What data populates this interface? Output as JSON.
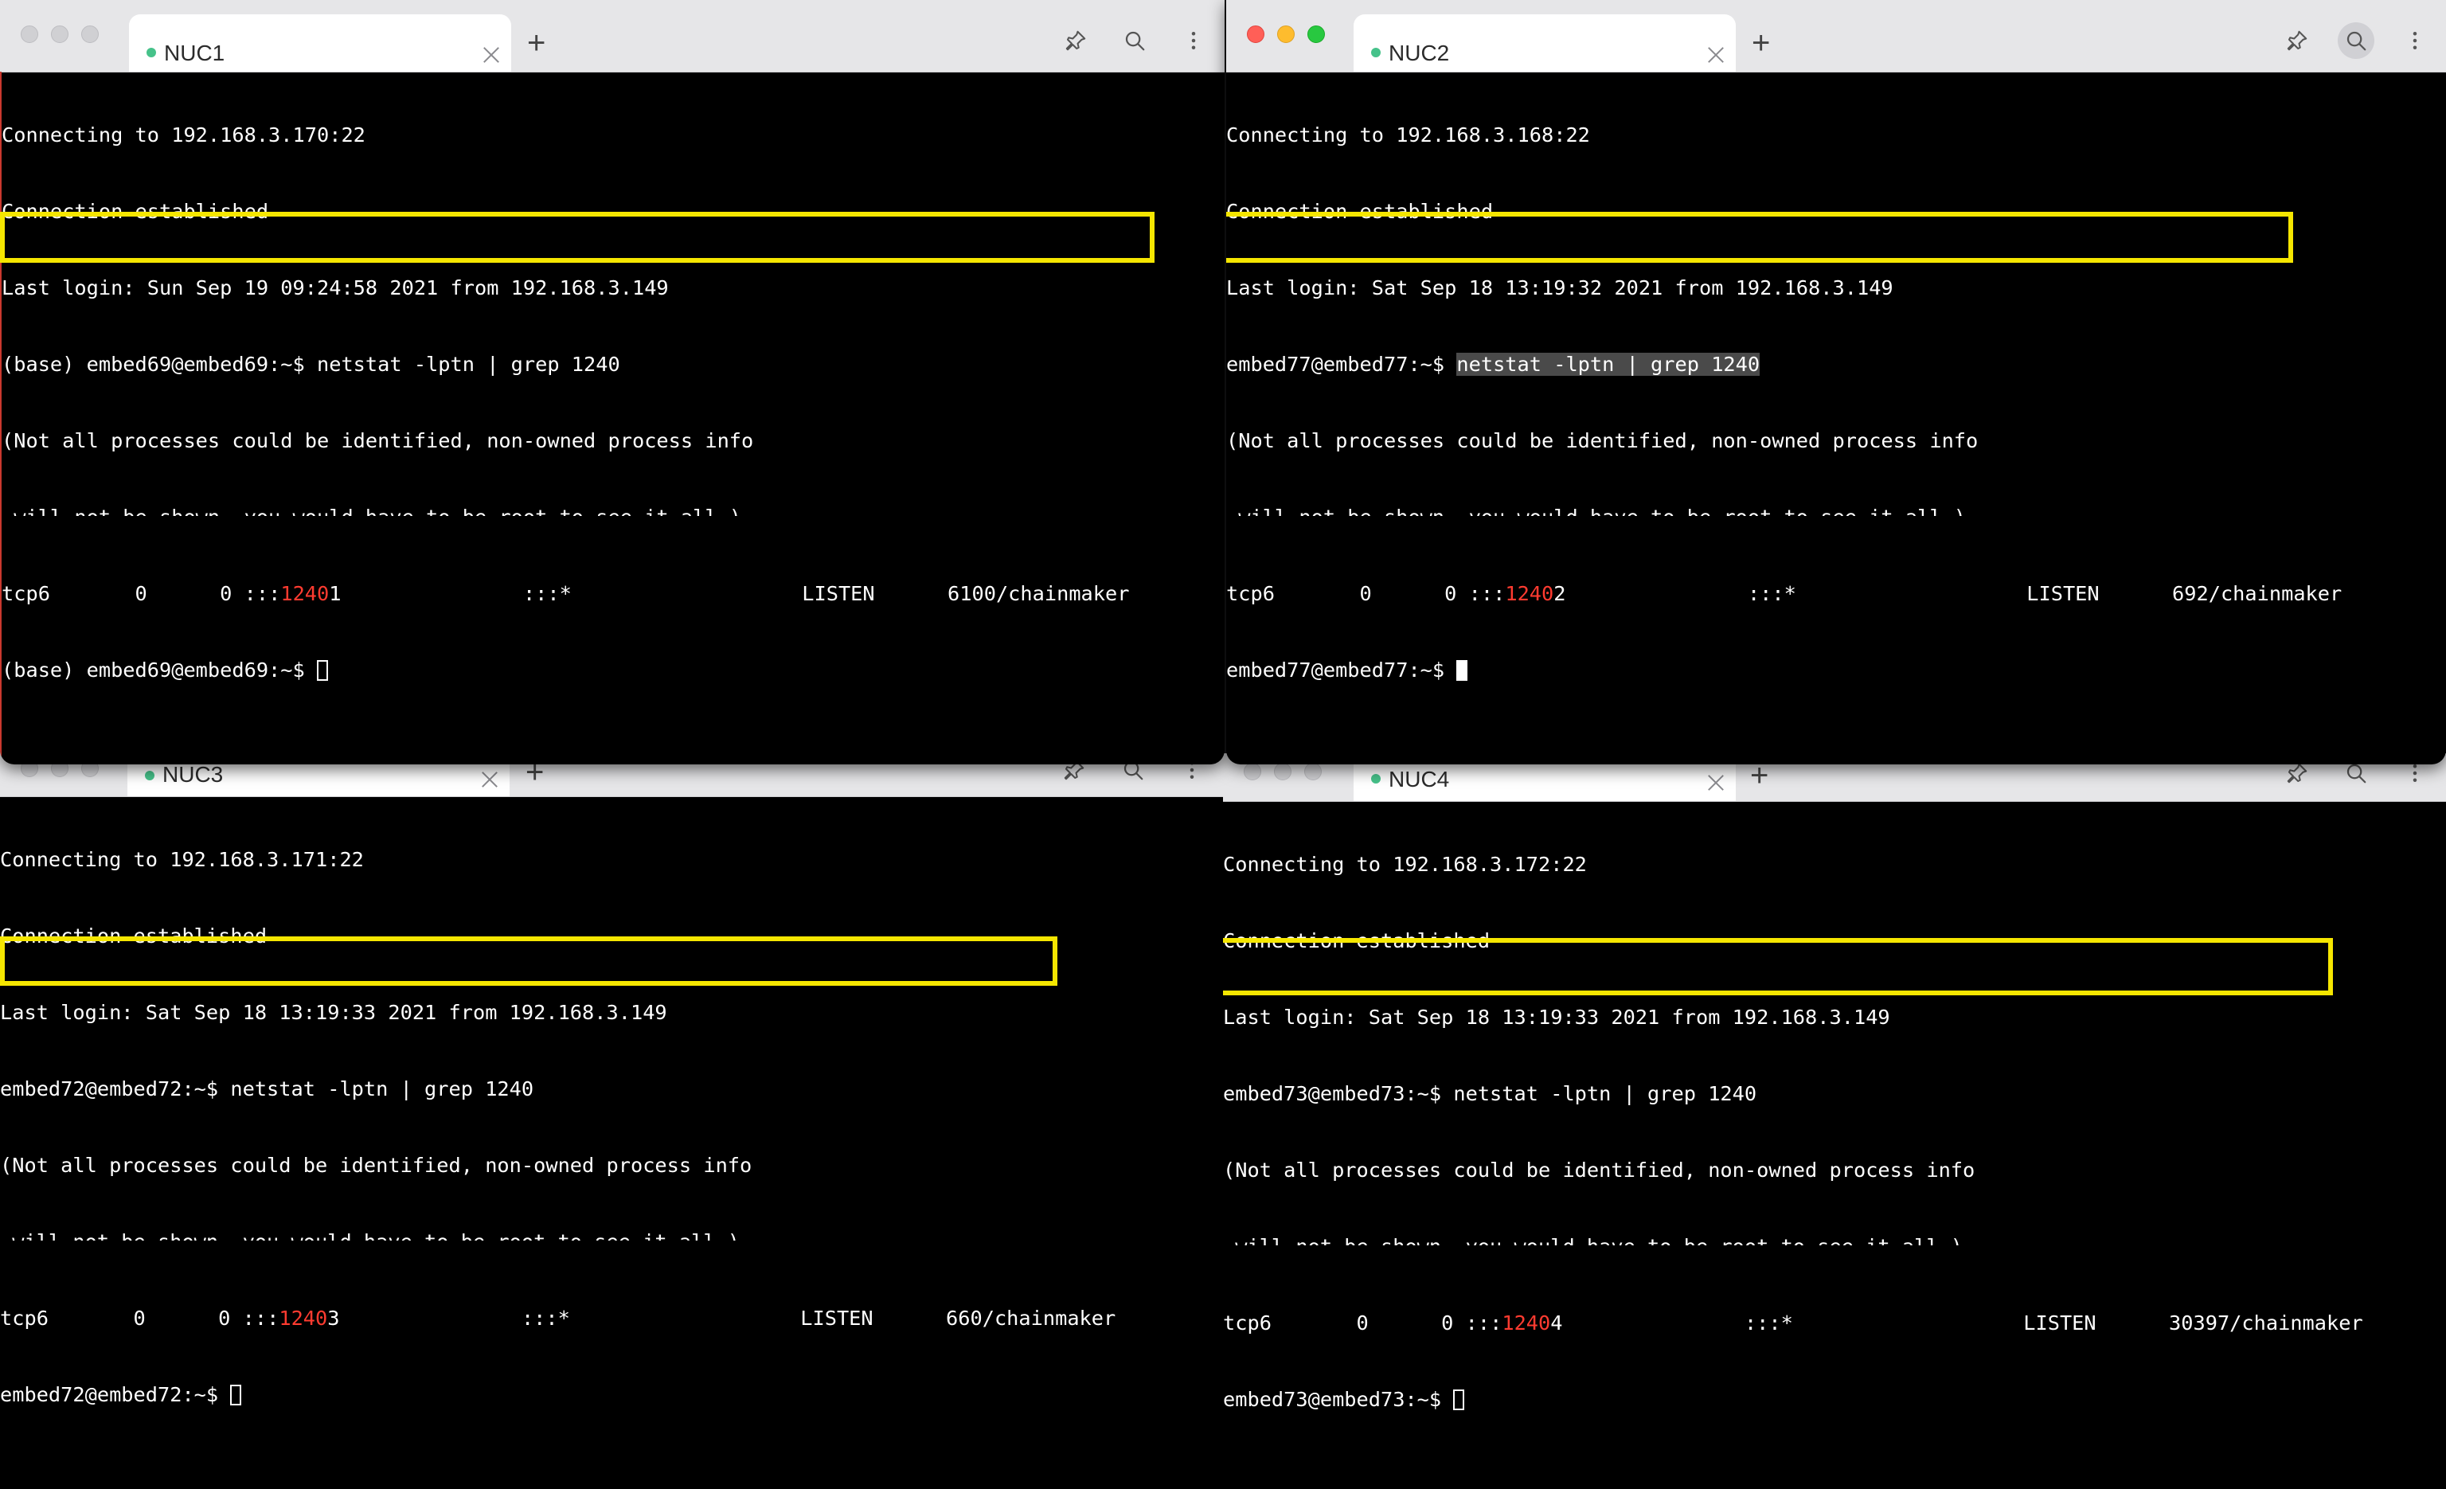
{
  "windows": [
    {
      "tab_title": "NUC1",
      "lines": [
        "Connecting to 192.168.3.170:22",
        "Connection established",
        "Last login: Sun Sep 19 09:24:58 2021 from 192.168.3.149",
        "(base) embed69@embed69:~$ netstat -lptn | grep 1240",
        "(Not all processes could be identified, non-owned process info",
        " will not be shown, you would have to be root to see it all.)"
      ],
      "result": {
        "proto": "tcp6",
        "recvq": "0",
        "sendq": "0",
        "addr_prefix": ":::",
        "port_match": "1240",
        "port_rest": "1",
        "foreign": ":::*",
        "state": "LISTEN",
        "pid": "6100/chainmaker"
      },
      "prompt": "(base) embed69@embed69:~$ "
    },
    {
      "tab_title": "NUC2",
      "lines": [
        "Connecting to 192.168.3.168:22",
        "Connection established",
        "Last login: Sat Sep 18 13:19:32 2021 from 192.168.3.149"
      ],
      "cmd_prompt": "embed77@embed77:~$ ",
      "cmd_selected": "netstat -lptn | grep 1240",
      "lines_after": [
        "(Not all processes could be identified, non-owned process info",
        " will not be shown, you would have to be root to see it all.)"
      ],
      "result": {
        "proto": "tcp6",
        "recvq": "0",
        "sendq": "0",
        "addr_prefix": ":::",
        "port_match": "1240",
        "port_rest": "2",
        "foreign": ":::*",
        "state": "LISTEN",
        "pid": "692/chainmaker"
      },
      "prompt": "embed77@embed77:~$ "
    },
    {
      "tab_title": "NUC3",
      "lines": [
        "Connecting to 192.168.3.171:22",
        "Connection established",
        "Last login: Sat Sep 18 13:19:33 2021 from 192.168.3.149",
        "embed72@embed72:~$ netstat -lptn | grep 1240",
        "(Not all processes could be identified, non-owned process info",
        " will not be shown, you would have to be root to see it all.)"
      ],
      "result": {
        "proto": "tcp6",
        "recvq": "0",
        "sendq": "0",
        "addr_prefix": ":::",
        "port_match": "1240",
        "port_rest": "3",
        "foreign": ":::*",
        "state": "LISTEN",
        "pid": "660/chainmaker"
      },
      "prompt": "embed72@embed72:~$ "
    },
    {
      "tab_title": "NUC4",
      "lines": [
        "Connecting to 192.168.3.172:22",
        "Connection established",
        "Last login: Sat Sep 18 13:19:33 2021 from 192.168.3.149",
        "embed73@embed73:~$ netstat -lptn | grep 1240",
        "(Not all processes could be identified, non-owned process info",
        " will not be shown, you would have to be root to see it all.)"
      ],
      "result": {
        "proto": "tcp6",
        "recvq": "0",
        "sendq": "0",
        "addr_prefix": ":::",
        "port_match": "1240",
        "port_rest": "4",
        "foreign": ":::*",
        "state": "LISTEN",
        "pid": "30397/chainmaker"
      },
      "prompt": "embed73@embed73:~$ "
    }
  ],
  "colors": {
    "highlight_box": "#f5e600",
    "port_match": "#ff3b30",
    "terminal_bg": "#000000",
    "terminal_fg": "#ffffff"
  },
  "icons": [
    "pin-icon",
    "search-icon",
    "more-icon",
    "close-icon",
    "plus-icon",
    "cursor-icon"
  ]
}
